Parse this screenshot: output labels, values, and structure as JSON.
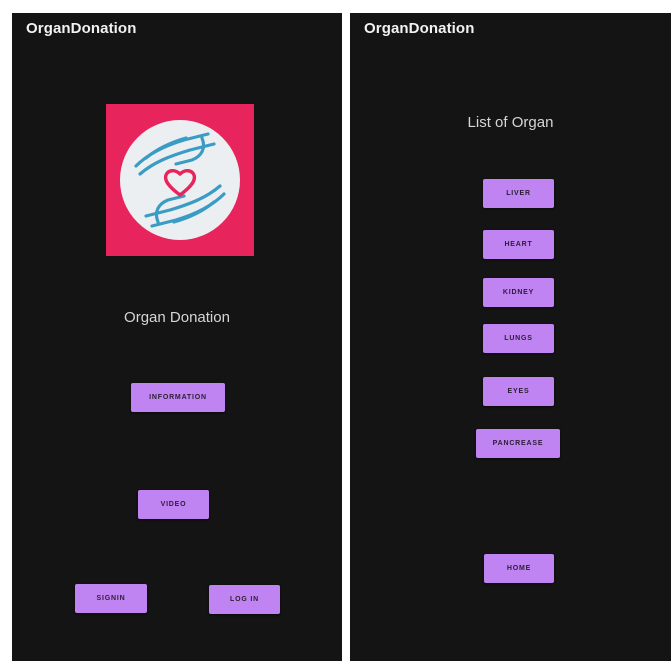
{
  "left_screen": {
    "app_title": "OrganDonation",
    "heading": "Organ Donation",
    "buttons": {
      "information": "INFORMATION",
      "video": "VIDEO",
      "signin": "SIGNIN",
      "login": "LOG IN"
    }
  },
  "right_screen": {
    "app_title": "OrganDonation",
    "heading": "List of Organ",
    "organs": [
      "LIVER",
      "HEART",
      "KIDNEY",
      "LUNGS",
      "EYES",
      "PANCREASE"
    ],
    "home": "HOME"
  },
  "colors": {
    "background": "#141414",
    "button": "#c083f2",
    "logo_background": "#e8245c",
    "hands": "#3a9cc4",
    "heart": "#e8245c"
  },
  "icons": {
    "logo": "hands-holding-heart-icon"
  }
}
